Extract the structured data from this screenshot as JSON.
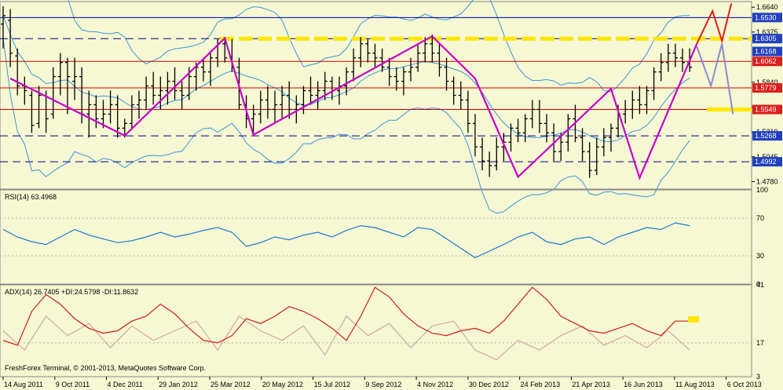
{
  "chart_data": [
    {
      "type": "ohlc",
      "panel": "price",
      "ylim": [
        1.47,
        1.67
      ],
      "y_ticks": [
        {
          "value": 1.664,
          "label": "1.6640"
        },
        {
          "value": 1.6375,
          "label": "1.6375"
        },
        {
          "value": 1.584,
          "label": "1.5840"
        },
        {
          "value": 1.557,
          "label": "1.5570"
        },
        {
          "value": 1.531,
          "label": "1.5310"
        },
        {
          "value": 1.5045,
          "label": "1.5045"
        },
        {
          "value": 1.478,
          "label": "1.4780"
        }
      ],
      "x_ticks": [
        "14 Aug 2011",
        "9 Oct 2011",
        "4 Dec 2011",
        "29 Jan 2012",
        "25 Mar 2012",
        "20 May 2012",
        "15 Jul 2012",
        "9 Sep 2012",
        "4 Nov 2012",
        "30 Dec 2012",
        "24 Feb 2013",
        "21 Apr 2013",
        "16 Jun 2013",
        "11 Aug 2013",
        "6 Oct 2013"
      ],
      "levels": [
        {
          "value": 1.653,
          "label": "1.6530",
          "style": "solid",
          "color": "#0000aa"
        },
        {
          "value": 1.6305,
          "label": "1.6305",
          "style": "dashed",
          "color": "#000080"
        },
        {
          "value": 1.6168,
          "label": "1.6168",
          "style": "none",
          "color": "#000080"
        },
        {
          "value": 1.6062,
          "label": "1.6062",
          "style": "solid",
          "color": "#cc0000"
        },
        {
          "value": 1.5779,
          "label": "1.5779",
          "style": "solid",
          "color": "#cc0000"
        },
        {
          "value": 1.5549,
          "label": "1.5549",
          "style": "solid",
          "color": "#cc0000"
        },
        {
          "value": 1.5268,
          "label": "1.5268",
          "style": "dashed",
          "color": "#000080"
        },
        {
          "value": 1.4992,
          "label": "1.4992",
          "style": "dashed",
          "color": "#000080"
        }
      ],
      "zigzag": [
        [
          1,
          1.588
        ],
        [
          17,
          1.527
        ],
        [
          31,
          1.631
        ],
        [
          35,
          1.528
        ],
        [
          60,
          1.633
        ],
        [
          66,
          1.588
        ],
        [
          72,
          1.483
        ],
        [
          85,
          1.577
        ],
        [
          89,
          1.482
        ],
        [
          97,
          1.625
        ]
      ],
      "bars": [
        [
          0,
          1.646,
          1.665,
          1.62,
          1.655
        ],
        [
          1,
          1.65,
          1.662,
          1.6,
          1.615
        ],
        [
          2,
          1.612,
          1.62,
          1.57,
          1.58
        ],
        [
          3,
          1.58,
          1.59,
          1.56,
          1.575
        ],
        [
          4,
          1.57,
          1.575,
          1.53,
          1.538
        ],
        [
          5,
          1.54,
          1.58,
          1.535,
          1.57
        ],
        [
          6,
          1.57,
          1.575,
          1.53,
          1.545
        ],
        [
          7,
          1.55,
          1.6,
          1.545,
          1.59
        ],
        [
          8,
          1.59,
          1.615,
          1.57,
          1.605
        ],
        [
          9,
          1.605,
          1.61,
          1.55,
          1.59
        ],
        [
          10,
          1.585,
          1.61,
          1.565,
          1.59
        ],
        [
          11,
          1.59,
          1.6,
          1.54,
          1.55
        ],
        [
          12,
          1.55,
          1.575,
          1.525,
          1.56
        ],
        [
          13,
          1.56,
          1.57,
          1.535,
          1.545
        ],
        [
          14,
          1.545,
          1.565,
          1.535,
          1.55
        ],
        [
          15,
          1.55,
          1.575,
          1.54,
          1.56
        ],
        [
          16,
          1.56,
          1.57,
          1.525,
          1.535
        ],
        [
          17,
          1.535,
          1.545,
          1.525,
          1.54
        ],
        [
          18,
          1.54,
          1.57,
          1.535,
          1.56
        ],
        [
          19,
          1.56,
          1.575,
          1.545,
          1.565
        ],
        [
          20,
          1.565,
          1.59,
          1.555,
          1.58
        ],
        [
          21,
          1.58,
          1.595,
          1.56,
          1.57
        ],
        [
          22,
          1.57,
          1.59,
          1.555,
          1.575
        ],
        [
          23,
          1.575,
          1.595,
          1.56,
          1.585
        ],
        [
          24,
          1.585,
          1.6,
          1.565,
          1.575
        ],
        [
          25,
          1.575,
          1.585,
          1.555,
          1.57
        ],
        [
          26,
          1.57,
          1.6,
          1.565,
          1.59
        ],
        [
          27,
          1.59,
          1.605,
          1.575,
          1.6
        ],
        [
          28,
          1.6,
          1.61,
          1.585,
          1.595
        ],
        [
          29,
          1.595,
          1.615,
          1.58,
          1.61
        ],
        [
          30,
          1.61,
          1.63,
          1.6,
          1.625
        ],
        [
          31,
          1.625,
          1.632,
          1.605,
          1.61
        ],
        [
          32,
          1.61,
          1.63,
          1.595,
          1.6
        ],
        [
          33,
          1.6,
          1.61,
          1.555,
          1.56
        ],
        [
          34,
          1.56,
          1.57,
          1.535,
          1.545
        ],
        [
          35,
          1.545,
          1.56,
          1.528,
          1.55
        ],
        [
          36,
          1.55,
          1.575,
          1.54,
          1.565
        ],
        [
          37,
          1.565,
          1.58,
          1.545,
          1.555
        ],
        [
          38,
          1.555,
          1.575,
          1.54,
          1.56
        ],
        [
          39,
          1.56,
          1.58,
          1.545,
          1.57
        ],
        [
          40,
          1.57,
          1.585,
          1.545,
          1.555
        ],
        [
          41,
          1.555,
          1.57,
          1.54,
          1.56
        ],
        [
          42,
          1.56,
          1.58,
          1.55,
          1.575
        ],
        [
          43,
          1.575,
          1.59,
          1.56,
          1.57
        ],
        [
          44,
          1.57,
          1.585,
          1.555,
          1.575
        ],
        [
          45,
          1.575,
          1.595,
          1.565,
          1.585
        ],
        [
          46,
          1.585,
          1.59,
          1.565,
          1.575
        ],
        [
          47,
          1.575,
          1.59,
          1.56,
          1.58
        ],
        [
          48,
          1.58,
          1.6,
          1.57,
          1.595
        ],
        [
          49,
          1.595,
          1.62,
          1.585,
          1.61
        ],
        [
          50,
          1.61,
          1.632,
          1.6,
          1.625
        ],
        [
          51,
          1.625,
          1.63,
          1.605,
          1.615
        ],
        [
          52,
          1.615,
          1.625,
          1.6,
          1.61
        ],
        [
          53,
          1.61,
          1.62,
          1.595,
          1.6
        ],
        [
          54,
          1.6,
          1.61,
          1.58,
          1.59
        ],
        [
          55,
          1.59,
          1.6,
          1.575,
          1.585
        ],
        [
          56,
          1.585,
          1.6,
          1.57,
          1.595
        ],
        [
          57,
          1.595,
          1.61,
          1.585,
          1.6
        ],
        [
          58,
          1.6,
          1.625,
          1.595,
          1.615
        ],
        [
          59,
          1.615,
          1.632,
          1.605,
          1.625
        ],
        [
          60,
          1.625,
          1.635,
          1.605,
          1.615
        ],
        [
          61,
          1.615,
          1.625,
          1.59,
          1.6
        ],
        [
          62,
          1.6,
          1.61,
          1.575,
          1.585
        ],
        [
          63,
          1.585,
          1.59,
          1.56,
          1.57
        ],
        [
          64,
          1.57,
          1.585,
          1.555,
          1.565
        ],
        [
          65,
          1.565,
          1.575,
          1.53,
          1.54
        ],
        [
          66,
          1.54,
          1.55,
          1.505,
          1.515
        ],
        [
          67,
          1.515,
          1.525,
          1.49,
          1.5
        ],
        [
          68,
          1.5,
          1.51,
          1.483,
          1.495
        ],
        [
          69,
          1.495,
          1.525,
          1.49,
          1.515
        ],
        [
          70,
          1.515,
          1.53,
          1.5,
          1.52
        ],
        [
          71,
          1.52,
          1.54,
          1.51,
          1.535
        ],
        [
          72,
          1.535,
          1.545,
          1.52,
          1.53
        ],
        [
          73,
          1.53,
          1.55,
          1.52,
          1.545
        ],
        [
          74,
          1.545,
          1.565,
          1.535,
          1.555
        ],
        [
          75,
          1.555,
          1.565,
          1.53,
          1.54
        ],
        [
          76,
          1.54,
          1.55,
          1.52,
          1.53
        ],
        [
          77,
          1.53,
          1.54,
          1.5,
          1.51
        ],
        [
          78,
          1.51,
          1.53,
          1.5,
          1.52
        ],
        [
          79,
          1.52,
          1.55,
          1.51,
          1.545
        ],
        [
          80,
          1.545,
          1.56,
          1.52,
          1.525
        ],
        [
          81,
          1.525,
          1.535,
          1.5,
          1.51
        ],
        [
          82,
          1.51,
          1.52,
          1.482,
          1.49
        ],
        [
          83,
          1.49,
          1.525,
          1.485,
          1.515
        ],
        [
          84,
          1.515,
          1.535,
          1.505,
          1.525
        ],
        [
          85,
          1.525,
          1.54,
          1.51,
          1.535
        ],
        [
          86,
          1.535,
          1.56,
          1.525,
          1.55
        ],
        [
          87,
          1.55,
          1.565,
          1.54,
          1.555
        ],
        [
          88,
          1.555,
          1.575,
          1.545,
          1.565
        ],
        [
          89,
          1.565,
          1.58,
          1.55,
          1.56
        ],
        [
          90,
          1.56,
          1.58,
          1.55,
          1.575
        ],
        [
          91,
          1.575,
          1.6,
          1.565,
          1.595
        ],
        [
          92,
          1.595,
          1.615,
          1.585,
          1.605
        ],
        [
          93,
          1.605,
          1.625,
          1.595,
          1.615
        ],
        [
          94,
          1.615,
          1.625,
          1.6,
          1.61
        ],
        [
          95,
          1.61,
          1.62,
          1.595,
          1.605
        ],
        [
          96,
          1.605,
          1.62,
          1.595,
          1.6
        ]
      ]
    },
    {
      "type": "line",
      "panel": "rsi",
      "title": "RSI(14) 63.4968",
      "ylim": [
        0,
        100
      ],
      "y_ticks": [
        100,
        70,
        30,
        0
      ],
      "series": [
        {
          "name": "",
          "color": "#1e78d2",
          "x": [
            0,
            2,
            4,
            6,
            8,
            10,
            12,
            14,
            16,
            18,
            20,
            22,
            24,
            26,
            28,
            30,
            32,
            34,
            36,
            38,
            40,
            42,
            44,
            46,
            48,
            50,
            52,
            54,
            56,
            58,
            60,
            62,
            64,
            66,
            68,
            70,
            72,
            74,
            76,
            78,
            80,
            82,
            84,
            86,
            88,
            90,
            92,
            94,
            96
          ],
          "y": [
            58,
            50,
            45,
            42,
            50,
            58,
            52,
            48,
            44,
            46,
            50,
            55,
            50,
            53,
            57,
            60,
            55,
            40,
            44,
            50,
            47,
            52,
            55,
            50,
            57,
            62,
            60,
            55,
            50,
            60,
            58,
            48,
            38,
            28,
            35,
            42,
            50,
            55,
            45,
            42,
            48,
            50,
            42,
            50,
            55,
            60,
            58,
            65,
            62
          ]
        }
      ]
    },
    {
      "type": "line",
      "panel": "adx",
      "title": "ADX(14) 26.7405 +DI:24.5798 -DI:11.8632",
      "ylim": [
        3,
        41
      ],
      "y_ticks": [
        41,
        17,
        3
      ],
      "series": [
        {
          "name": "",
          "color": "#cc1e1e",
          "x": [
            0,
            2,
            4,
            6,
            8,
            10,
            12,
            14,
            16,
            18,
            20,
            22,
            24,
            26,
            28,
            30,
            32,
            34,
            36,
            38,
            40,
            42,
            44,
            46,
            48,
            50,
            52,
            54,
            56,
            58,
            60,
            62,
            64,
            66,
            68,
            70,
            72,
            74,
            76,
            78,
            80,
            82,
            84,
            86,
            88,
            90,
            92,
            94,
            96
          ],
          "y": [
            18,
            16,
            30,
            37,
            33,
            27,
            23,
            21,
            22,
            26,
            28,
            33,
            29,
            23,
            18,
            17,
            20,
            27,
            25,
            28,
            32,
            30,
            27,
            23,
            18,
            28,
            40,
            36,
            29,
            24,
            21,
            20,
            22,
            23,
            21,
            26,
            33,
            40,
            35,
            28,
            25,
            22,
            21,
            23,
            25,
            22,
            20,
            26,
            26
          ]
        },
        {
          "name": "",
          "color": "#d2aaaa",
          "x": [
            0,
            3,
            6,
            9,
            12,
            15,
            18,
            21,
            24,
            27,
            30,
            33,
            36,
            39,
            42,
            45,
            48,
            51,
            54,
            57,
            60,
            63,
            66,
            69,
            72,
            75,
            78,
            81,
            84,
            87,
            90,
            93,
            96
          ],
          "y": [
            22,
            14,
            28,
            20,
            25,
            15,
            24,
            18,
            22,
            26,
            14,
            28,
            22,
            18,
            24,
            12,
            28,
            20,
            25,
            15,
            24,
            26,
            14,
            10,
            18,
            14,
            20,
            24,
            16,
            20,
            15,
            22,
            14
          ]
        }
      ]
    }
  ],
  "footer": {
    "copyright": "FreshForex Terminal, © 2001-2013, MetaQuotes Software Corp."
  }
}
